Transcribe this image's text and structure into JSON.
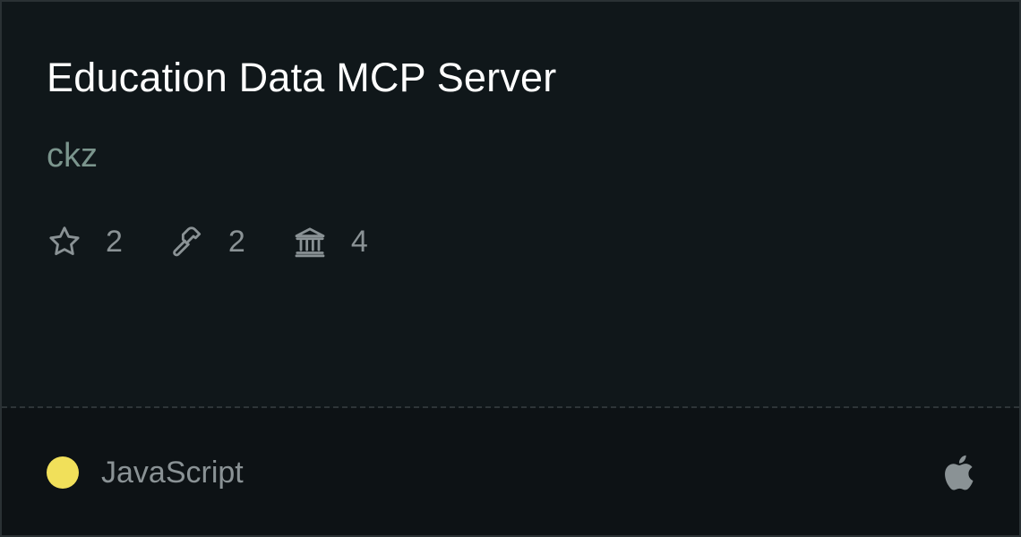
{
  "card": {
    "title": "Education Data MCP Server",
    "author": "ckz",
    "stats": [
      {
        "icon": "star-icon",
        "value": "2"
      },
      {
        "icon": "hammer-icon",
        "value": "2"
      },
      {
        "icon": "bank-icon",
        "value": "4"
      }
    ],
    "language": {
      "label": "JavaScript",
      "color": "#f1e05a"
    },
    "platform_icon": "apple-icon"
  },
  "colors": {
    "background": "#10171a",
    "footer_background": "#0d1215",
    "title": "#ffffff",
    "author": "#7b958d",
    "muted": "#8a9295"
  }
}
